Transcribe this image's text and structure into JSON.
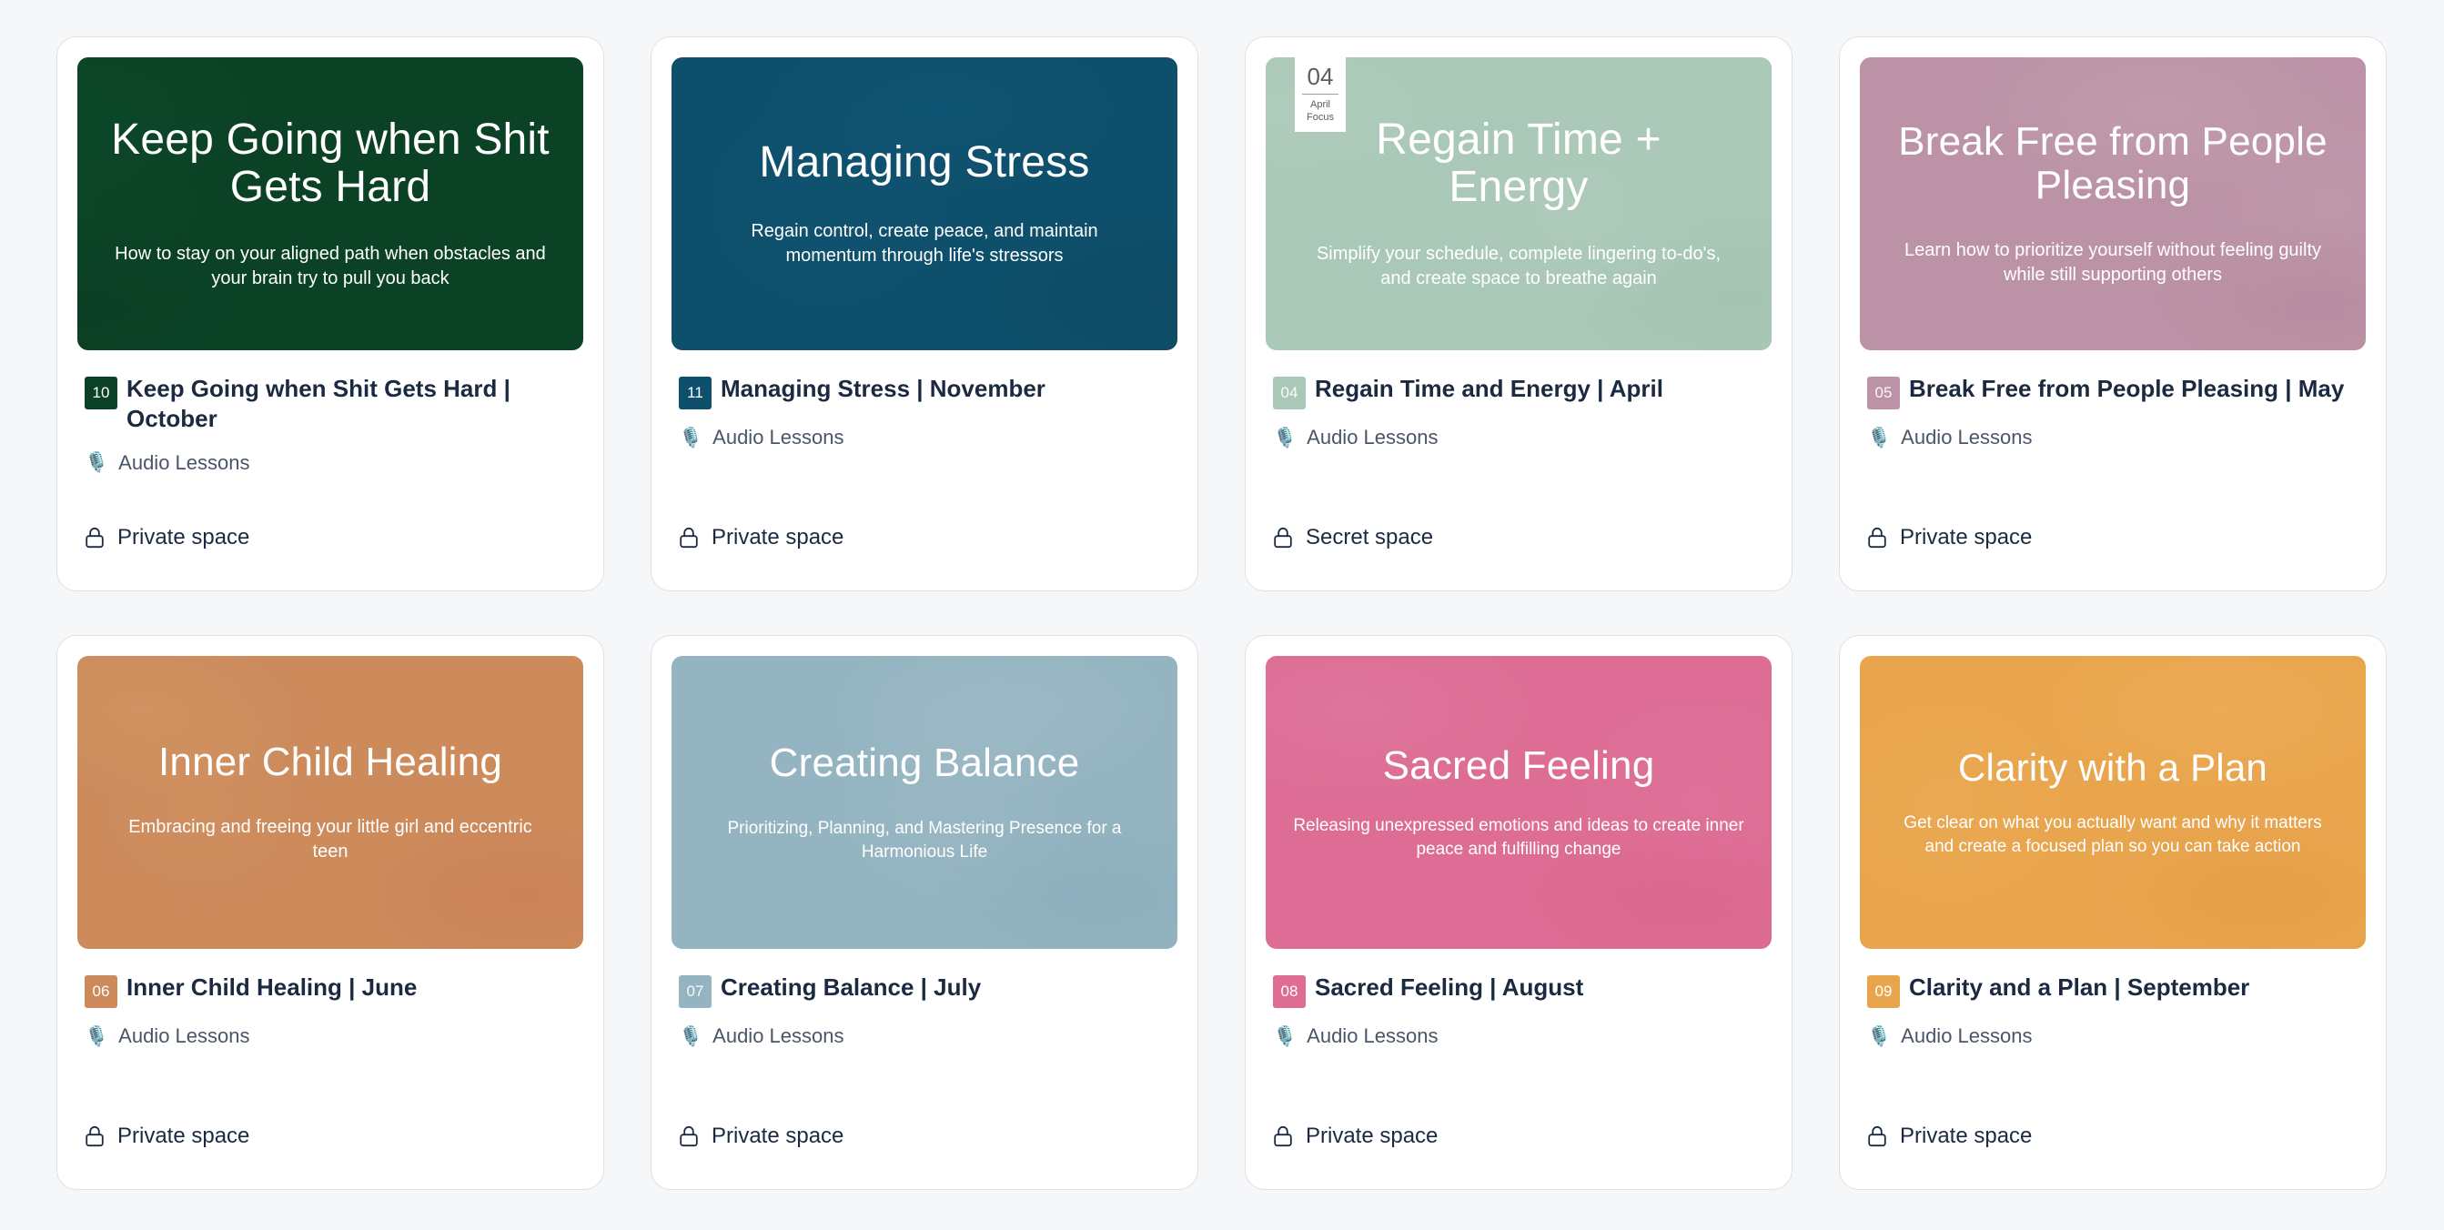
{
  "page": {
    "background": "#f5f7f9"
  },
  "icons": {
    "mic": "🎙️",
    "lock": "lock-icon"
  },
  "cards": [
    {
      "cover_title": "Keep Going when Shit Gets Hard",
      "cover_subtitle": "How to stay on your aligned path when obstacles and your brain try to pull you back",
      "cover_color": "#0b4226",
      "number": "10",
      "title": "Keep Going when Shit Gets Hard | October",
      "audio_label": "Audio Lessons",
      "space_label": "Private space",
      "focus_badge": null
    },
    {
      "cover_title": "Managing Stress",
      "cover_subtitle": "Regain control, create peace, and maintain momentum through life's stressors",
      "cover_color": "#0e4f6b",
      "number": "11",
      "title": "Managing Stress | November",
      "audio_label": "Audio Lessons",
      "space_label": "Private space",
      "focus_badge": null
    },
    {
      "cover_title": "Regain Time + Energy",
      "cover_subtitle": "Simplify your schedule, complete lingering to-do's, and create space to breathe again",
      "cover_color": "#aac8b7",
      "number": "04",
      "title": "Regain Time and Energy | April",
      "audio_label": "Audio Lessons",
      "space_label": "Secret space",
      "focus_badge": {
        "number": "04",
        "line1": "April",
        "line2": "Focus"
      }
    },
    {
      "cover_title": "Break Free from People Pleasing",
      "cover_subtitle": "Learn how to prioritize yourself without feeling guilty while still supporting others",
      "cover_color": "#bc93a6",
      "number": "05",
      "title": "Break Free from People Pleasing | May",
      "audio_label": "Audio Lessons",
      "space_label": "Private space",
      "focus_badge": null
    },
    {
      "cover_title": "Inner Child Healing",
      "cover_subtitle": "Embracing and freeing your little girl and eccentric teen",
      "cover_color": "#cd8a5b",
      "number": "06",
      "title": "Inner Child Healing | June",
      "audio_label": "Audio Lessons",
      "space_label": "Private space",
      "focus_badge": null
    },
    {
      "cover_title": "Creating Balance",
      "cover_subtitle": "Prioritizing, Planning, and Mastering Presence for a Harmonious Life",
      "cover_color": "#94b4c1",
      "number": "07",
      "title": "Creating Balance | July",
      "audio_label": "Audio Lessons",
      "space_label": "Private space",
      "focus_badge": null
    },
    {
      "cover_title": "Sacred Feeling",
      "cover_subtitle": "Releasing unexpressed emotions and ideas to create inner peace and fulfilling change",
      "cover_color": "#dd6d94",
      "number": "08",
      "title": "Sacred Feeling | August",
      "audio_label": "Audio Lessons",
      "space_label": "Private space",
      "focus_badge": null
    },
    {
      "cover_title": "Clarity with a Plan",
      "cover_subtitle": "Get clear on what you actually want and why it matters and create a focused plan so you can take action",
      "cover_color": "#e9a košice"
    }
  ]
}
